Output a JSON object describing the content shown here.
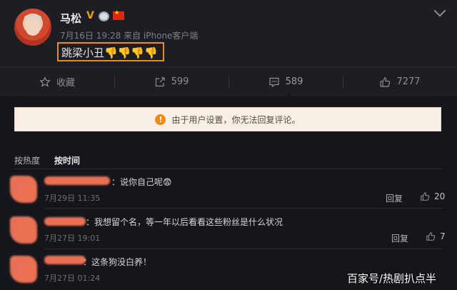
{
  "post": {
    "author": "马松",
    "verified_mark": "V",
    "meta": "7月16日 19:28 来自 iPhone客户端",
    "text": "跳梁小丑",
    "text_emoji": "👎👎👎👎"
  },
  "actions": [
    {
      "icon": "star-icon",
      "label": "收藏"
    },
    {
      "icon": "share-icon",
      "label": "599"
    },
    {
      "icon": "comment-icon",
      "label": "589"
    },
    {
      "icon": "like-icon",
      "label": "7277"
    }
  ],
  "notice": {
    "icon": "warning-icon",
    "symbol": "!",
    "text": "由于用户设置，你无法回复评论。"
  },
  "sort": {
    "hot": "按热度",
    "time": "按时间"
  },
  "comments": [
    {
      "text": "：说你自己呢😨",
      "time": "7月29日 11:35",
      "reply": "回复",
      "likes": "20"
    },
    {
      "text": "：我想留个名，等一年以后看看这些粉丝是什么状况",
      "time": "7月27日 19:01",
      "reply": "回复",
      "likes": "7"
    },
    {
      "text": "：这条狗没白养！",
      "time": "7月27日 01:24",
      "reply": "",
      "likes": ""
    }
  ],
  "watermark": "百家号/热剧扒点半",
  "colors": {
    "accent": "#f08a12",
    "background": "#15161b",
    "card": "#1d1e24",
    "redaction": "#ea7054"
  }
}
